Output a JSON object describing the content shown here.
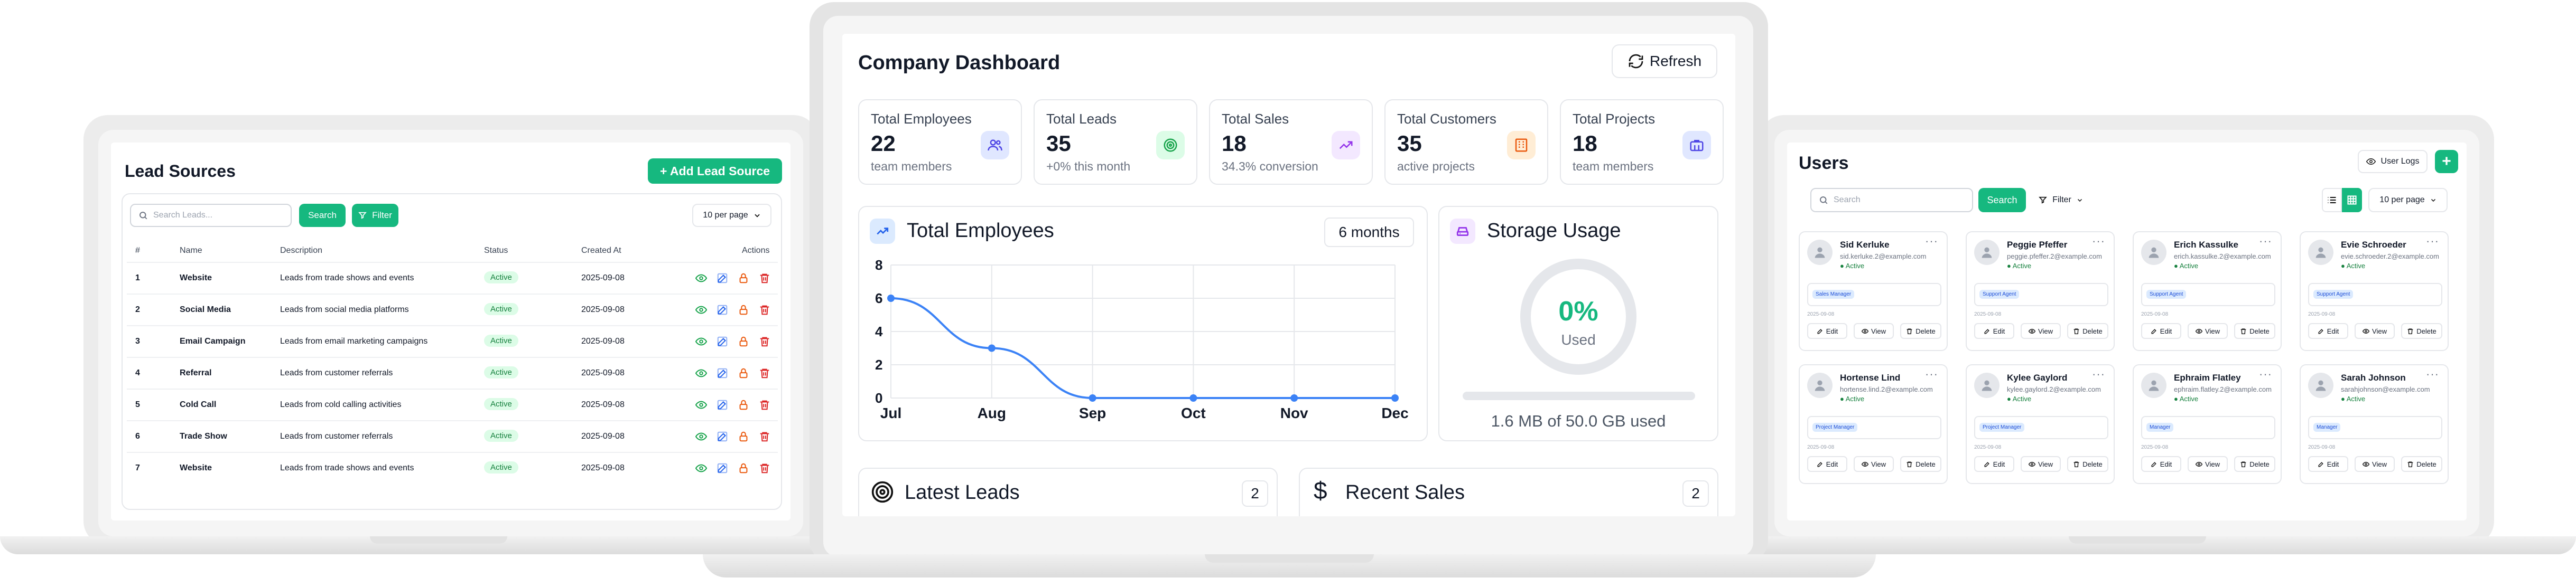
{
  "lead_sources": {
    "title": "Lead Sources",
    "add_button": "+ Add Lead Source",
    "search_placeholder": "Search Leads...",
    "search_button": "Search",
    "filter_button": "Filter",
    "per_page": "10 per page",
    "columns": [
      "#",
      "Name",
      "Description",
      "Status",
      "Created At",
      "Actions"
    ],
    "rows": [
      {
        "num": "1",
        "name": "Website",
        "desc": "Leads from trade shows and events",
        "status": "Active",
        "date": "2025-09-08"
      },
      {
        "num": "2",
        "name": "Social Media",
        "desc": "Leads from social media platforms",
        "status": "Active",
        "date": "2025-09-08"
      },
      {
        "num": "3",
        "name": "Email Campaign",
        "desc": "Leads from email marketing campaigns",
        "status": "Active",
        "date": "2025-09-08"
      },
      {
        "num": "4",
        "name": "Referral",
        "desc": "Leads from customer referrals",
        "status": "Active",
        "date": "2025-09-08"
      },
      {
        "num": "5",
        "name": "Cold Call",
        "desc": "Leads from cold calling activities",
        "status": "Active",
        "date": "2025-09-08"
      },
      {
        "num": "6",
        "name": "Trade Show",
        "desc": "Leads from customer referrals",
        "status": "Active",
        "date": "2025-09-08"
      },
      {
        "num": "7",
        "name": "Website",
        "desc": "Leads from trade shows and events",
        "status": "Active",
        "date": "2025-09-08"
      }
    ]
  },
  "dashboard": {
    "title": "Company Dashboard",
    "refresh": "Refresh",
    "stats": [
      {
        "title": "Total Employees",
        "value": "22",
        "sub": "team members",
        "icon": "users-icon",
        "color": "#4f46e5",
        "bg": "#e0e7ff"
      },
      {
        "title": "Total Leads",
        "value": "35",
        "sub": "+0% this month",
        "icon": "target-icon",
        "color": "#16a34a",
        "bg": "#dcfce7"
      },
      {
        "title": "Total Sales",
        "value": "18",
        "sub": "34.3% conversion",
        "icon": "trending-up-icon",
        "color": "#9333ea",
        "bg": "#f3e8ff"
      },
      {
        "title": "Total Customers",
        "value": "35",
        "sub": "active projects",
        "icon": "building-icon",
        "color": "#ea580c",
        "bg": "#ffedd5"
      },
      {
        "title": "Total Projects",
        "value": "18",
        "sub": "team members",
        "icon": "briefcase-icon",
        "color": "#4f46e5",
        "bg": "#e0e7ff"
      }
    ],
    "employees_chart_title": "Total Employees",
    "range": "6 months",
    "storage_title": "Storage Usage",
    "storage_percent": "0%",
    "storage_used_label": "Used",
    "storage_fraction": 0,
    "storage_text": "1.6 MB of 50.0 GB used",
    "latest_leads_title": "Latest Leads",
    "latest_leads_count": "2",
    "recent_sales_title": "Recent Sales",
    "recent_sales_count": "2"
  },
  "chart_data": {
    "type": "line",
    "title": "Total Employees",
    "categories": [
      "Jul",
      "Aug",
      "Sep",
      "Oct",
      "Nov",
      "Dec"
    ],
    "series": [
      {
        "values": [
          6,
          3,
          0,
          0,
          0,
          0
        ]
      }
    ],
    "y_ticks": [
      "8",
      "6",
      "4",
      "2",
      "0"
    ],
    "ylim": [
      0,
      8
    ],
    "color": "#3b82f6",
    "grid": true
  },
  "users": {
    "title": "Users",
    "user_logs": "User Logs",
    "search_placeholder": "Search",
    "search_button": "Search",
    "filter_button": "Filter",
    "per_page": "10 per page",
    "edit": "Edit",
    "view": "View",
    "delete": "Delete",
    "cards": [
      {
        "name": "Sid Kerluke",
        "email": "sid.kerluke.2@example.com",
        "status": "Active",
        "role": "Sales Manager",
        "date": "2025-09-08"
      },
      {
        "name": "Peggie Pfeffer",
        "email": "peggie.pfeffer.2@example.com",
        "status": "Active",
        "role": "Support Agent",
        "date": "2025-09-08"
      },
      {
        "name": "Erich Kassulke",
        "email": "erich.kassulke.2@example.com",
        "status": "Active",
        "role": "Support Agent",
        "date": "2025-09-08"
      },
      {
        "name": "Evie Schroeder",
        "email": "evie.schroeder.2@example.com",
        "status": "Active",
        "role": "Support Agent",
        "date": "2025-09-08"
      },
      {
        "name": "Hortense Lind",
        "email": "hortense.lind.2@example.com",
        "status": "Active",
        "role": "Project Manager",
        "date": "2025-09-08"
      },
      {
        "name": "Kylee Gaylord",
        "email": "kylee.gaylord.2@example.com",
        "status": "Active",
        "role": "Project Manager",
        "date": "2025-09-08"
      },
      {
        "name": "Ephraim Flatley",
        "email": "ephraim.flatley.2@example.com",
        "status": "Active",
        "role": "Manager",
        "date": "2025-09-08"
      },
      {
        "name": "Sarah Johnson",
        "email": "sarahjohnson@example.com",
        "status": "Active",
        "role": "Manager",
        "date": "2025-09-08"
      }
    ]
  }
}
